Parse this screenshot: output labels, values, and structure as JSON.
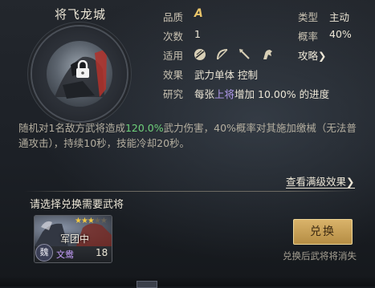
{
  "skill": {
    "name": "将飞龙城",
    "labels": {
      "quality": "品质",
      "type": "类型",
      "count": "次数",
      "rate": "概率",
      "applicable": "适用",
      "effect": "效果",
      "research": "研究"
    },
    "quality": "A",
    "type": "主动",
    "count": "1",
    "rate": "40%",
    "applicable_icons": [
      "shield-icon",
      "bow-icon",
      "spear-icon",
      "horse-icon"
    ],
    "strategy_link": "攻略",
    "strategy_arrow": "❯",
    "effect": "武力单体 控制",
    "research": {
      "prefix": "每张",
      "highlight": "上将",
      "suffix": "增加 10.00% 的进度"
    },
    "description": {
      "part1": "随机对1名敌方武将造成",
      "highlight": "120.0%",
      "part2": "武力伤害，40%概率对其施加缴械（无法普通攻击），持续10秒，技能冷却20秒。"
    }
  },
  "view_full": "查看满级效果",
  "view_full_arrow": "❯",
  "select_title": "请选择兑换需要武将",
  "general_card": {
    "name": "军团中",
    "stars_filled": "★★★",
    "stars_empty": "★★",
    "faction": "魏",
    "school": "文鸯",
    "level": "18"
  },
  "exchange_button": "兑换",
  "exchange_note": "兑换后武将将消失"
}
